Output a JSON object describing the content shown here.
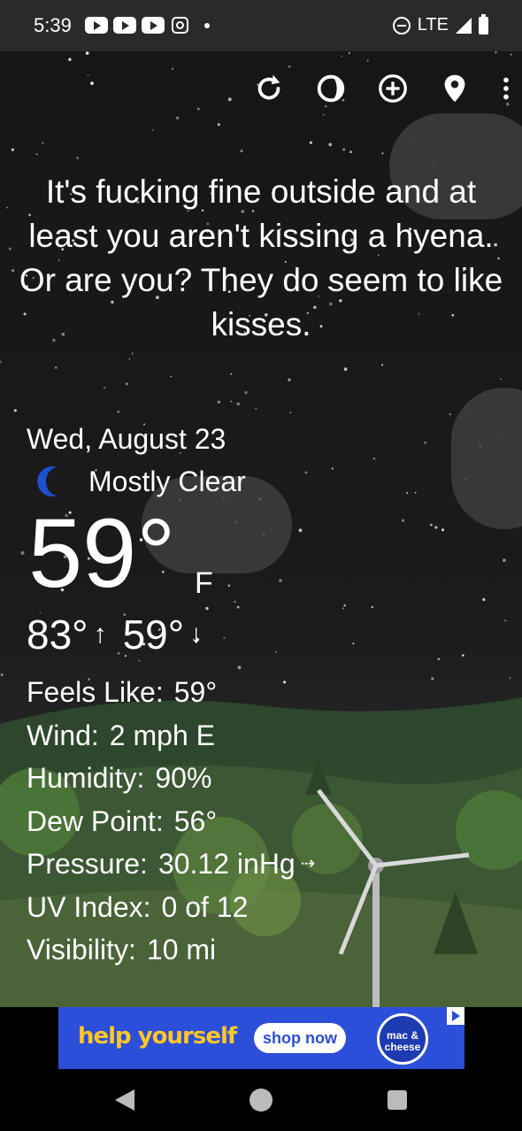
{
  "status_bar": {
    "time": "5:39",
    "network": "LTE",
    "notification_icons": [
      "youtube-icon",
      "youtube-icon",
      "youtube-icon",
      "instagram-icon"
    ]
  },
  "toolbar": {
    "icons": [
      "refresh-icon",
      "theme-icon",
      "add-location-icon",
      "location-pin-icon",
      "more-options-icon"
    ]
  },
  "headline": "It's fucking fine outside and at least you aren't kissing a hyena. Or are you? They do seem to like kisses.",
  "weather": {
    "date": "Wed, August 23",
    "condition": "Mostly Clear",
    "temperature": "59°",
    "unit": "F",
    "high": "83°",
    "low": "59°",
    "details": [
      {
        "label": "Feels Like:",
        "value": "59°"
      },
      {
        "label": "Wind:",
        "value": "2 mph E"
      },
      {
        "label": "Humidity:",
        "value": "90%"
      },
      {
        "label": "Dew Point:",
        "value": "56°"
      },
      {
        "label": "Pressure:",
        "value": "30.12 inHg"
      },
      {
        "label": "UV Index:",
        "value": "0 of 12"
      },
      {
        "label": "Visibility:",
        "value": "10 mi"
      }
    ]
  },
  "ad": {
    "text": "help yourself",
    "button": "shop now",
    "logo": "mac & cheese"
  },
  "colors": {
    "ad_background": "#2b4fd8",
    "ad_text": "#ffc629",
    "moon": "#1e4fd1"
  }
}
